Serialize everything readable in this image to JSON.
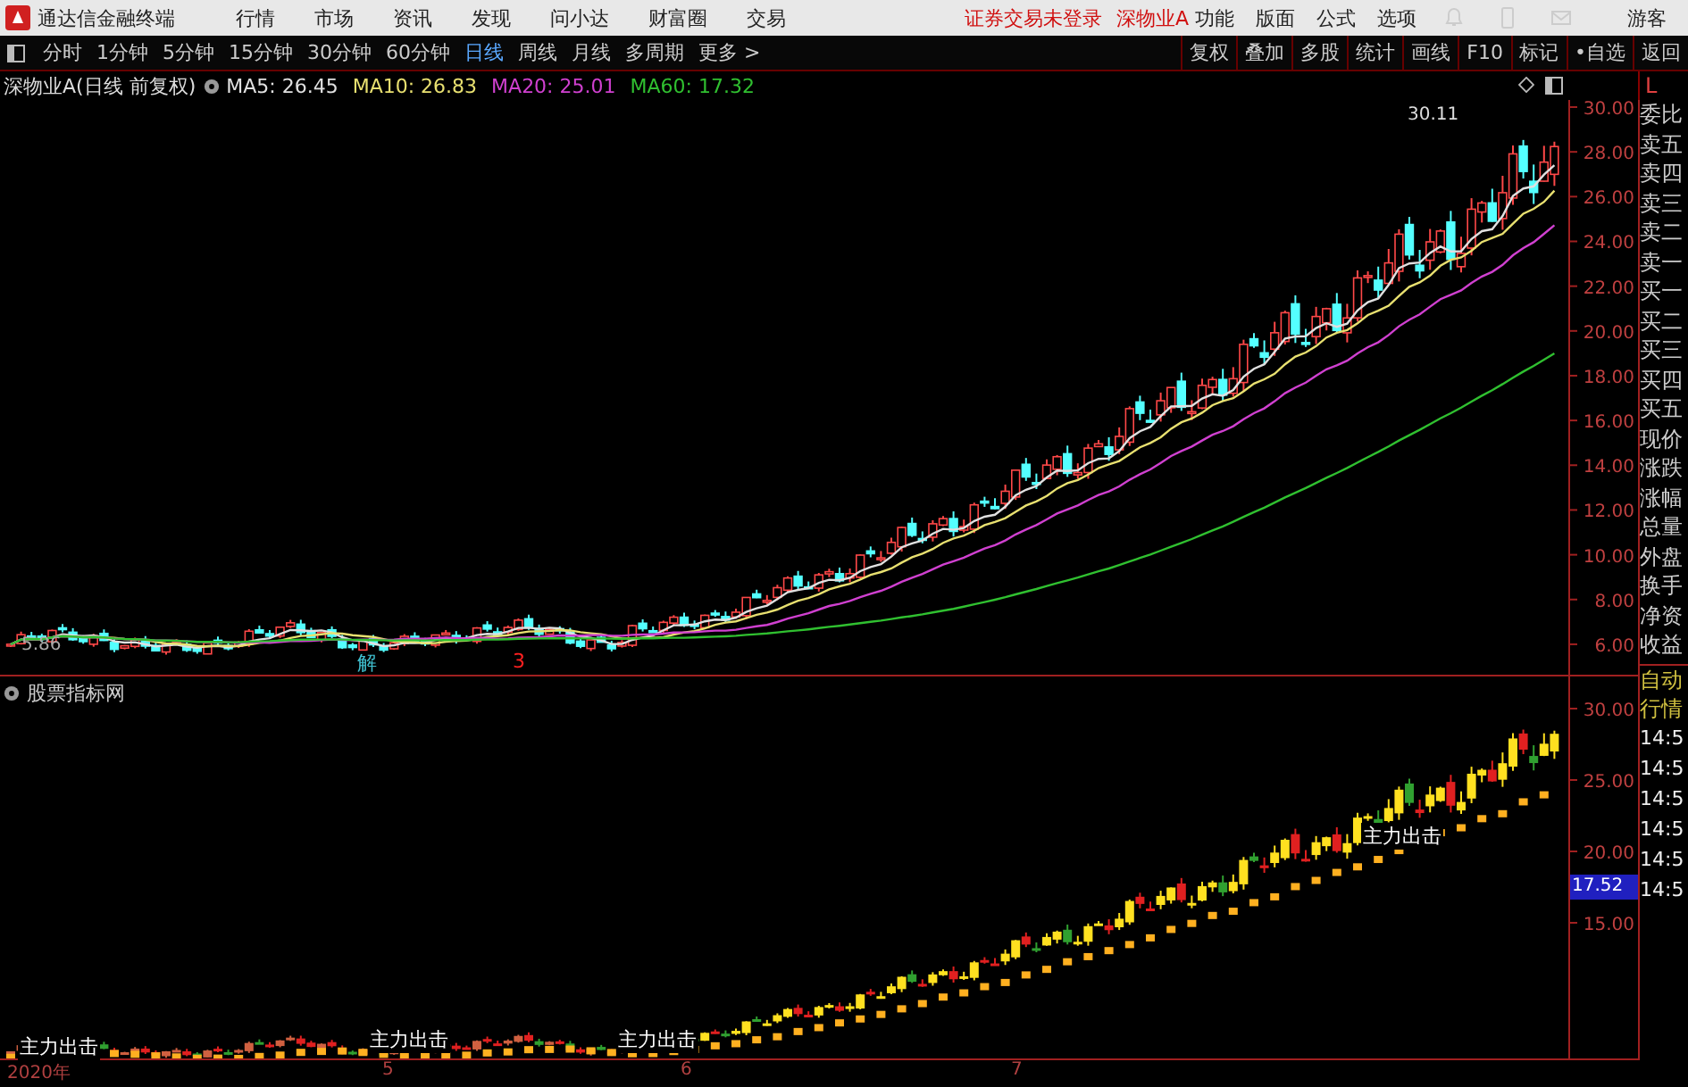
{
  "app": {
    "title": "通达信金融终端",
    "menus": [
      "行情",
      "市场",
      "资讯",
      "发现",
      "问小达",
      "财富圈",
      "交易"
    ],
    "status": [
      "证券交易未登录",
      "深物业A"
    ],
    "tools": [
      "功能",
      "版面",
      "公式",
      "选项"
    ],
    "user": "游客"
  },
  "periods": [
    {
      "label": "分时",
      "selected": false
    },
    {
      "label": "1分钟",
      "selected": false
    },
    {
      "label": "5分钟",
      "selected": false
    },
    {
      "label": "15分钟",
      "selected": false
    },
    {
      "label": "30分钟",
      "selected": false
    },
    {
      "label": "60分钟",
      "selected": false
    },
    {
      "label": "日线",
      "selected": true
    },
    {
      "label": "周线",
      "selected": false
    },
    {
      "label": "月线",
      "selected": false
    },
    {
      "label": "多周期",
      "selected": false
    },
    {
      "label": "更多 >",
      "selected": false
    }
  ],
  "actions": [
    "复权",
    "叠加",
    "多股",
    "统计",
    "画线",
    "F10",
    "标记",
    "•自选",
    "返回"
  ],
  "main_chart": {
    "title": "深物业A(日线 前复权)",
    "ma": [
      {
        "label": "MA5: 26.45",
        "color": "#e0e0e0"
      },
      {
        "label": "MA10: 26.83",
        "color": "#e8e070"
      },
      {
        "label": "MA20: 25.01",
        "color": "#d040d0"
      },
      {
        "label": "MA60: 17.32",
        "color": "#30c030"
      }
    ],
    "ticks": [
      "30.00",
      "28.00",
      "26.00",
      "24.00",
      "22.00",
      "20.00",
      "18.00",
      "16.00",
      "14.00",
      "12.00",
      "10.00",
      "8.00",
      "6.00"
    ],
    "high_label": "30.11",
    "low_label": "5.86",
    "markers": [
      {
        "text": "解",
        "color": "#40c0d0"
      },
      {
        "text": "3",
        "color": "#ff2020"
      }
    ]
  },
  "lower_chart": {
    "title": "股票指标网",
    "ticks": [
      "30.00",
      "25.00",
      "20.00",
      "15.00"
    ],
    "current": "17.52",
    "signals": [
      "主力出击",
      "主力出击",
      "主力出击",
      "主力出击"
    ]
  },
  "dates": [
    "2020年",
    "5",
    "6",
    "7"
  ],
  "sidebar": {
    "top": "L",
    "quotes": [
      "委比",
      "卖五",
      "卖四",
      "卖三",
      "卖二",
      "卖一",
      "买一",
      "买二",
      "买三",
      "买四",
      "买五",
      "现价",
      "涨跌",
      "涨幅",
      "总量",
      "外盘",
      "换手",
      "净资",
      "收益"
    ],
    "feed_title": [
      "自动",
      "行情"
    ],
    "times": [
      "14:5",
      "14:5",
      "14:5",
      "14:5",
      "14:5",
      "14:5"
    ]
  }
}
